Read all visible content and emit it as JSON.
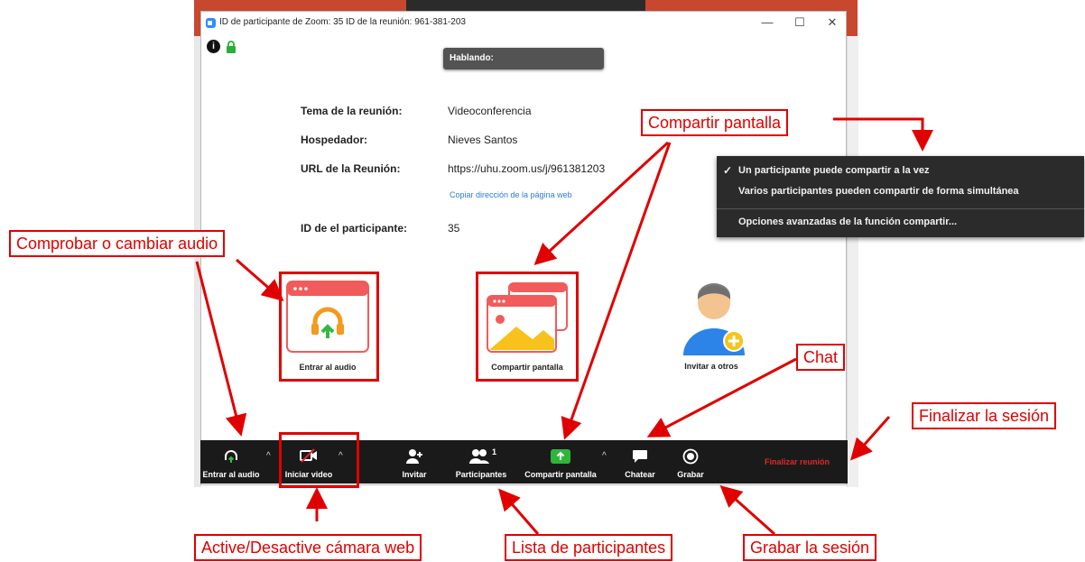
{
  "window": {
    "title": "ID de participante de Zoom: 35   ID de la reunión: 961-381-203",
    "speaking_label": "Hablando:",
    "info_icon_glyph": "i"
  },
  "meeting_info": {
    "topic_label": "Tema de la reunión:",
    "topic_value": "Videoconferencia",
    "host_label": "Hospedador:",
    "host_value": "Nieves Santos",
    "url_label": "URL de la Reunión:",
    "url_value": "https://uhu.zoom.us/j/961381203",
    "copy_link": "Copiar dirección de la página web",
    "participant_id_label": "ID de el participante:",
    "participant_id_value": "35"
  },
  "tiles": {
    "join_audio": "Entrar al audio",
    "share_screen": "Compartir pantalla",
    "invite": "Invitar a otros"
  },
  "toolbar": {
    "audio": "Entrar al audio",
    "video": "Iniciar video",
    "invite": "Invitar",
    "participants": "Participantes",
    "participants_count": "1",
    "share": "Compartir pantalla",
    "chat": "Chatear",
    "record": "Grabar",
    "end": "Finalizar reunión",
    "caret": "^"
  },
  "share_menu": {
    "check": "✓",
    "option_one": "Un participante puede compartir a la vez",
    "option_multi": "Varios participantes pueden compartir de forma simultánea",
    "advanced": "Opciones avanzadas de la función compartir..."
  },
  "annotations": {
    "share_screen": "Compartir pantalla",
    "audio": "Comprobar o cambiar audio",
    "chat": "Chat",
    "end_session": "Finalizar la sesión",
    "camera": "Active/Desactive cámara web",
    "participants_list": "Lista de participantes",
    "record_session": "Grabar la sesión"
  },
  "colors": {
    "annotation_red": "#e00000",
    "toolbar_bg": "#1a1a1a",
    "share_green": "#2fb63a",
    "end_red": "#e02828",
    "zoom_blue": "#2d8cff"
  }
}
